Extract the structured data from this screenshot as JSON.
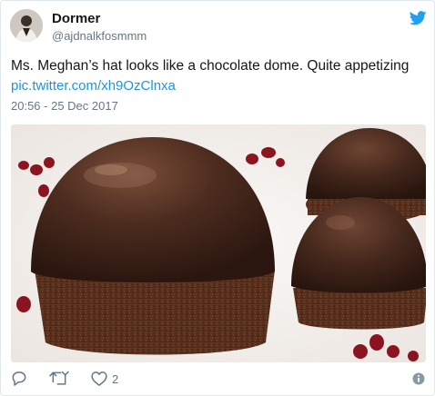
{
  "user": {
    "display_name": "Dormer",
    "handle": "@ajdnalkfosmmm"
  },
  "tweet": {
    "text": "Ms. Meghan’s hat looks like a chocolate dome. Quite appetizing",
    "link": "pic.twitter.com/xh9OzClnxa",
    "timestamp": "20:56 - 25 Dec 2017"
  },
  "actions": {
    "like_count": "2"
  },
  "colors": {
    "twitter_blue": "#1da1f2",
    "link_blue": "#1b95e0",
    "secondary_text": "#657786"
  },
  "icons": [
    "twitter-bird-icon",
    "reply-icon",
    "retweet-icon",
    "heart-icon",
    "info-icon"
  ]
}
